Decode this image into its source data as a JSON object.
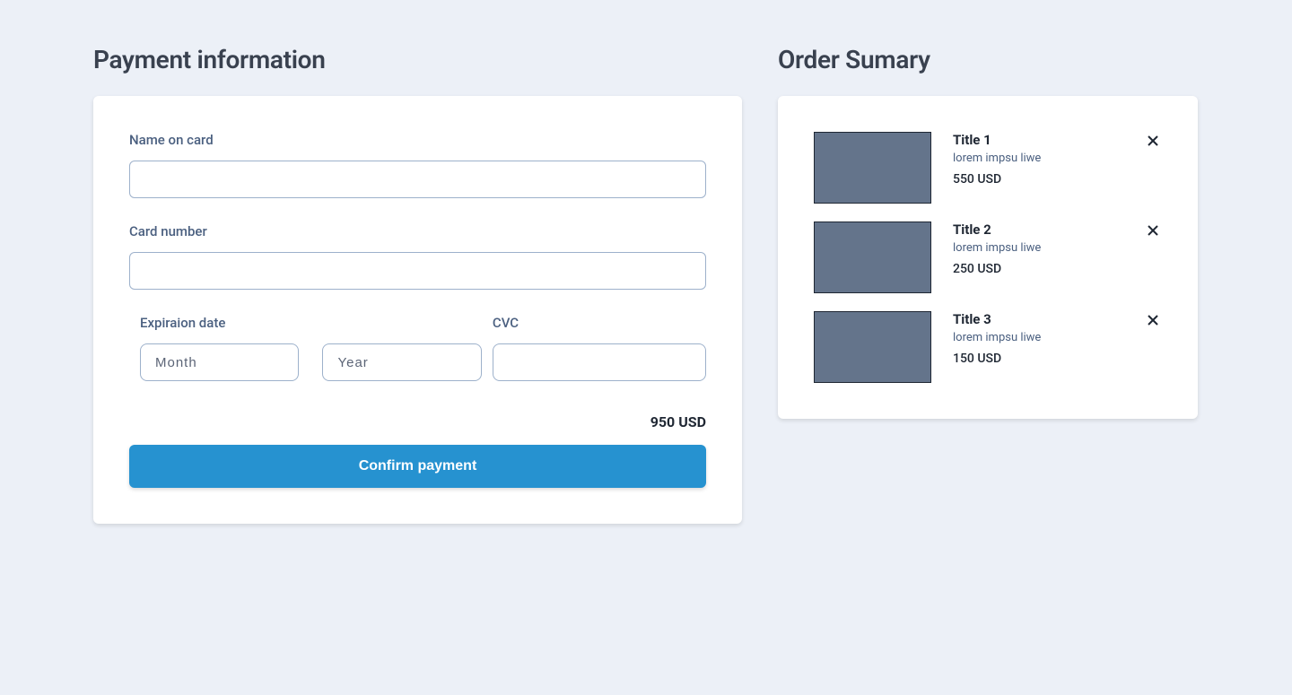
{
  "payment": {
    "heading": "Payment information",
    "name_label": "Name on card",
    "name_value": "",
    "card_label": "Card number",
    "card_value": "",
    "expiration_label": "Expiraion date",
    "month_placeholder": "Month",
    "year_placeholder": "Year",
    "cvc_label": "CVC",
    "cvc_value": "",
    "total": "950 USD",
    "confirm_label": "Confirm payment"
  },
  "order": {
    "heading": "Order Sumary",
    "items": [
      {
        "title": "Title 1",
        "subtitle": "lorem impsu liwe",
        "price": "550 USD"
      },
      {
        "title": "Title 2",
        "subtitle": "lorem impsu liwe",
        "price": "250 USD"
      },
      {
        "title": "Title 3",
        "subtitle": "lorem impsu liwe",
        "price": "150 USD"
      }
    ]
  }
}
